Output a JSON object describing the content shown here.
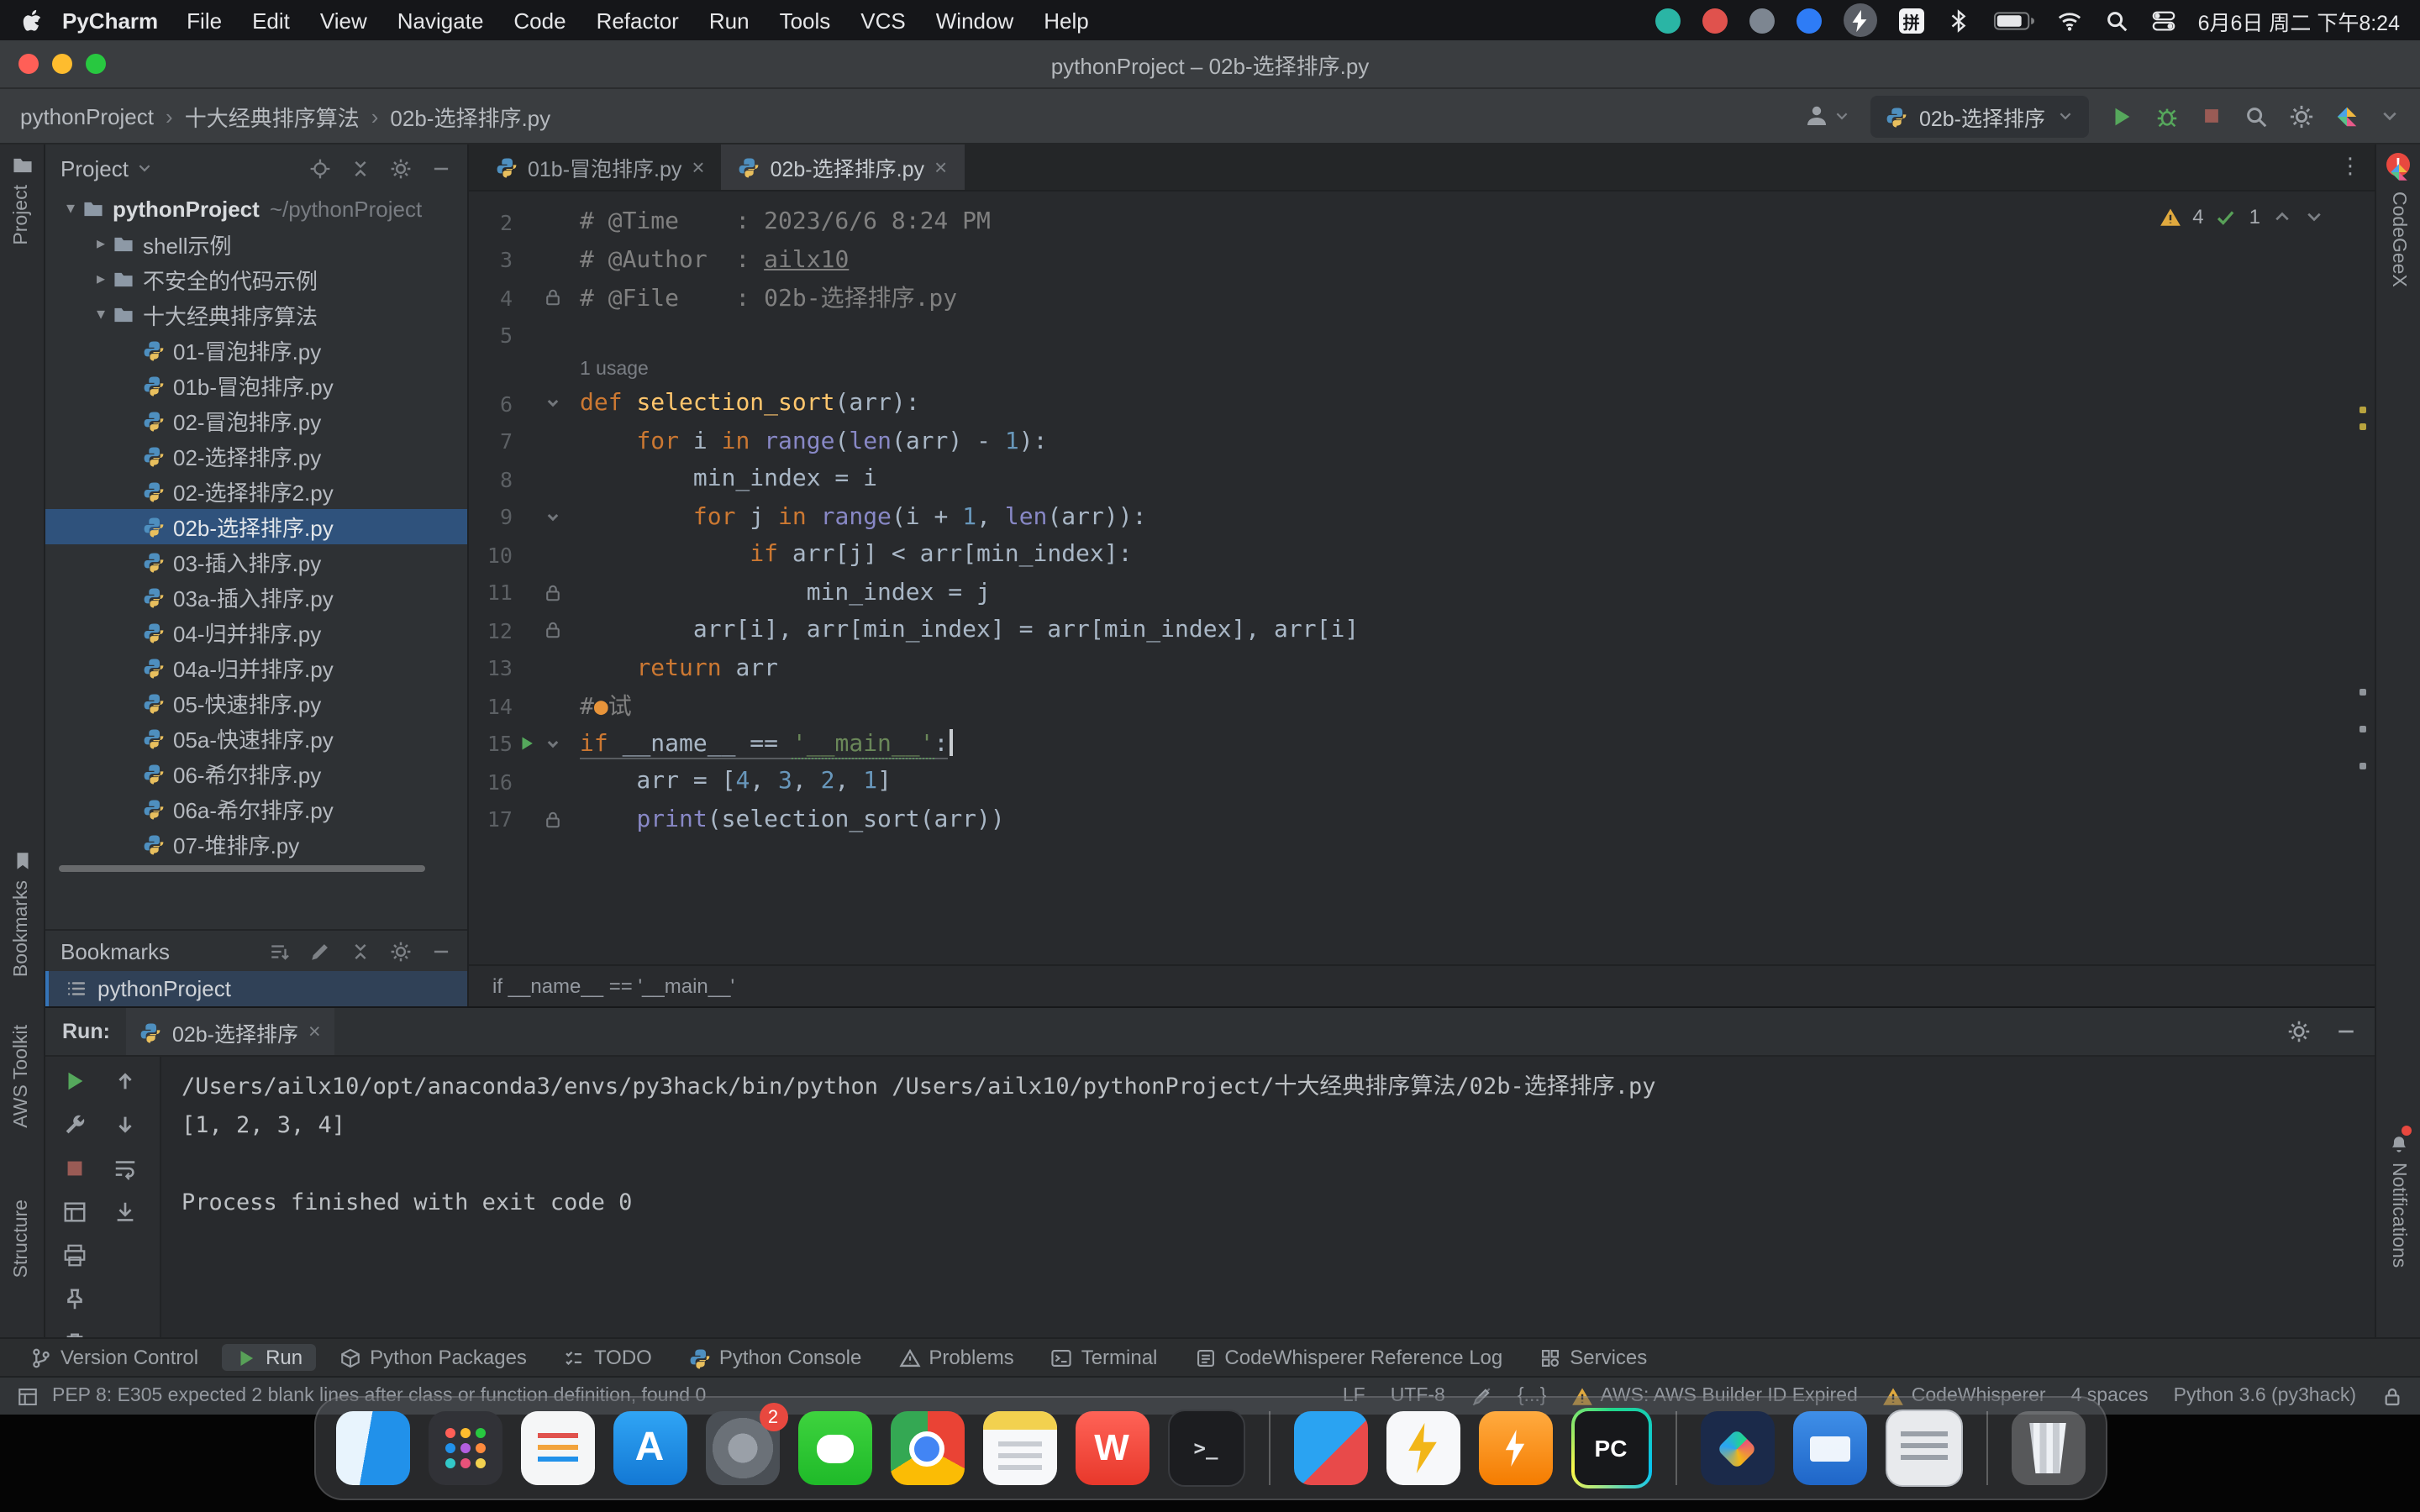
{
  "menubar": {
    "app_name": "PyCharm",
    "menus": [
      "File",
      "Edit",
      "View",
      "Navigate",
      "Code",
      "Refactor",
      "Run",
      "Tools",
      "VCS",
      "Window",
      "Help"
    ],
    "status_icons": [
      {
        "name": "status-teal-icon"
      },
      {
        "name": "status-red-icon"
      },
      {
        "name": "status-gray-icon"
      },
      {
        "name": "status-blue-icon"
      },
      {
        "name": "status-bolt-icon"
      },
      {
        "name": "input-method-icon",
        "glyph": "拼"
      },
      {
        "name": "bluetooth-icon"
      },
      {
        "name": "battery-icon"
      },
      {
        "name": "wifi-icon"
      },
      {
        "name": "spotlight-icon"
      },
      {
        "name": "control-center-icon"
      }
    ],
    "clock": "6月6日 周二 下午8:24"
  },
  "titlebar": {
    "title": "pythonProject – 02b-选择排序.py"
  },
  "toolbar": {
    "breadcrumbs": [
      "pythonProject",
      "十大经典排序算法",
      "02b-选择排序.py"
    ],
    "run_config": "02b-选择排序"
  },
  "left_stripe": {
    "items": [
      {
        "id": "project",
        "label": "Project",
        "icon": "folder-icon"
      },
      {
        "id": "bookmarks",
        "label": "Bookmarks",
        "icon": "bookmark-icon"
      },
      {
        "id": "aws",
        "label": "AWS Toolkit"
      },
      {
        "id": "structure",
        "label": "Structure"
      }
    ]
  },
  "right_stripe": {
    "items": [
      {
        "id": "codegeex",
        "label": "CodeGeeX",
        "icon": "codegeex-icon"
      },
      {
        "id": "notifications",
        "label": "Notifications",
        "icon": "bell-icon"
      }
    ]
  },
  "project": {
    "header": "Project",
    "header_icons": [
      "target-icon",
      "collapse-icon",
      "gear-icon",
      "minus-icon"
    ],
    "tree": [
      {
        "label": "pythonProject",
        "hint": "~/pythonProject",
        "type": "root",
        "indent": 0,
        "arrow": "expanded"
      },
      {
        "label": "shell示例",
        "type": "folder",
        "indent": 1,
        "arrow": "collapsed"
      },
      {
        "label": "不安全的代码示例",
        "type": "folder",
        "indent": 1,
        "arrow": "collapsed"
      },
      {
        "label": "十大经典排序算法",
        "type": "folder",
        "indent": 1,
        "arrow": "expanded"
      },
      {
        "label": "01-冒泡排序.py",
        "type": "pyfile",
        "indent": 2
      },
      {
        "label": "01b-冒泡排序.py",
        "type": "pyfile",
        "indent": 2
      },
      {
        "label": "02-冒泡排序.py",
        "type": "pyfile",
        "indent": 2
      },
      {
        "label": "02-选择排序.py",
        "type": "pyfile",
        "indent": 2
      },
      {
        "label": "02-选择排序2.py",
        "type": "pyfile",
        "indent": 2
      },
      {
        "label": "02b-选择排序.py",
        "type": "pyfile",
        "indent": 2,
        "selected": true
      },
      {
        "label": "03-插入排序.py",
        "type": "pyfile",
        "indent": 2
      },
      {
        "label": "03a-插入排序.py",
        "type": "pyfile",
        "indent": 2
      },
      {
        "label": "04-归并排序.py",
        "type": "pyfile",
        "indent": 2
      },
      {
        "label": "04a-归并排序.py",
        "type": "pyfile",
        "indent": 2
      },
      {
        "label": "05-快速排序.py",
        "type": "pyfile",
        "indent": 2
      },
      {
        "label": "05a-快速排序.py",
        "type": "pyfile",
        "indent": 2
      },
      {
        "label": "06-希尔排序.py",
        "type": "pyfile",
        "indent": 2
      },
      {
        "label": "06a-希尔排序.py",
        "type": "pyfile",
        "indent": 2
      },
      {
        "label": "07-堆排序.py",
        "type": "pyfile",
        "indent": 2
      }
    ]
  },
  "bookmarks": {
    "header": "Bookmarks",
    "header_icons": [
      "sort-icon",
      "pencil-icon",
      "collapse-icon",
      "gear-icon",
      "minus-icon"
    ],
    "items": [
      {
        "label": "pythonProject"
      }
    ]
  },
  "editor": {
    "tabs": [
      {
        "label": "01b-冒泡排序.py",
        "active": false
      },
      {
        "label": "02b-选择排序.py",
        "active": true
      }
    ],
    "inspections": {
      "warnings": "4",
      "passed": "1"
    },
    "breadcrumb": "if __name__ == '__main__'",
    "lines": [
      {
        "n": "2",
        "tokens": [
          {
            "t": "# @Time    : 2023/6/6 8:24 PM",
            "c": "com"
          }
        ]
      },
      {
        "n": "3",
        "tokens": [
          {
            "t": "# @Author  : ",
            "c": "com"
          },
          {
            "t": "ailx10",
            "c": "com und"
          }
        ]
      },
      {
        "n": "4",
        "g2": "lock",
        "tokens": [
          {
            "t": "# @File    : 02b-选择排序.py",
            "c": "com"
          }
        ]
      },
      {
        "n": "5",
        "tokens": []
      },
      {
        "hint": "1 usage"
      },
      {
        "n": "6",
        "g2": "fold",
        "tokens": [
          {
            "t": "def ",
            "c": "kw"
          },
          {
            "t": "selection_sort",
            "c": "fn"
          },
          {
            "t": "(arr):",
            "c": "pl"
          }
        ]
      },
      {
        "n": "7",
        "tokens": [
          {
            "t": "    ",
            "c": "pl"
          },
          {
            "t": "for ",
            "c": "kw"
          },
          {
            "t": "i ",
            "c": "pl"
          },
          {
            "t": "in ",
            "c": "kw"
          },
          {
            "t": "range",
            "c": "bi"
          },
          {
            "t": "(",
            "c": "pl"
          },
          {
            "t": "len",
            "c": "bi"
          },
          {
            "t": "(arr) - ",
            "c": "pl"
          },
          {
            "t": "1",
            "c": "num"
          },
          {
            "t": "):",
            "c": "pl"
          }
        ]
      },
      {
        "n": "8",
        "tokens": [
          {
            "t": "        min_index = i",
            "c": "pl"
          }
        ]
      },
      {
        "n": "9",
        "g2": "fold",
        "tokens": [
          {
            "t": "        ",
            "c": "pl"
          },
          {
            "t": "for ",
            "c": "kw"
          },
          {
            "t": "j ",
            "c": "pl"
          },
          {
            "t": "in ",
            "c": "kw"
          },
          {
            "t": "range",
            "c": "bi"
          },
          {
            "t": "(i + ",
            "c": "pl"
          },
          {
            "t": "1",
            "c": "num"
          },
          {
            "t": ", ",
            "c": "pl"
          },
          {
            "t": "len",
            "c": "bi"
          },
          {
            "t": "(arr)):",
            "c": "pl"
          }
        ]
      },
      {
        "n": "10",
        "tokens": [
          {
            "t": "            ",
            "c": "pl"
          },
          {
            "t": "if ",
            "c": "kw"
          },
          {
            "t": "arr[j] < arr[min_index]:",
            "c": "pl"
          }
        ]
      },
      {
        "n": "11",
        "g2": "lock",
        "tokens": [
          {
            "t": "                min_index = j",
            "c": "pl"
          }
        ]
      },
      {
        "n": "12",
        "g2": "lock",
        "tokens": [
          {
            "t": "        arr[i], arr[min_index] = arr[min_index], arr[i]",
            "c": "pl"
          }
        ]
      },
      {
        "n": "13",
        "tokens": [
          {
            "t": "    ",
            "c": "pl"
          },
          {
            "t": "return ",
            "c": "kw"
          },
          {
            "t": "arr",
            "c": "pl"
          }
        ]
      },
      {
        "n": "14",
        "tokens": [
          {
            "t": "#",
            "c": "com"
          },
          {
            "t": "●",
            "c": "dot"
          },
          {
            "t": "试",
            "c": "com"
          }
        ]
      },
      {
        "n": "15",
        "g1": "run",
        "g2": "fold",
        "cls": "caret-line",
        "tokens": [
          {
            "t": "if ",
            "c": "kw"
          },
          {
            "t": "__name__ == ",
            "c": "pl"
          },
          {
            "t": "'__main__'",
            "c": "str dotted"
          },
          {
            "t": ":",
            "c": "pl"
          }
        ]
      },
      {
        "n": "16",
        "tokens": [
          {
            "t": "    arr = [",
            "c": "pl"
          },
          {
            "t": "4",
            "c": "num"
          },
          {
            "t": ", ",
            "c": "pl"
          },
          {
            "t": "3",
            "c": "num"
          },
          {
            "t": ", ",
            "c": "pl"
          },
          {
            "t": "2",
            "c": "num"
          },
          {
            "t": ", ",
            "c": "pl"
          },
          {
            "t": "1",
            "c": "num"
          },
          {
            "t": "]",
            "c": "pl"
          }
        ]
      },
      {
        "n": "17",
        "g2": "lock",
        "tokens": [
          {
            "t": "    ",
            "c": "pl"
          },
          {
            "t": "print",
            "c": "bi"
          },
          {
            "t": "(selection_sort(arr))",
            "c": "pl"
          }
        ]
      }
    ]
  },
  "run_panel": {
    "label": "Run:",
    "tab": "02b-选择排序",
    "toolbar_col1": [
      "rerun-icon",
      "wrench-icon",
      "stop2-icon",
      "layout-icon",
      "printer-icon",
      "pin-icon",
      "trash-icon"
    ],
    "toolbar_col2": [
      "up-icon",
      "down-icon",
      "softwrap-icon",
      "scrollend-icon"
    ],
    "console": [
      "/Users/ailx10/opt/anaconda3/envs/py3hack/bin/python /Users/ailx10/pythonProject/十大经典排序算法/02b-选择排序.py",
      "[1, 2, 3, 4]",
      "",
      "Process finished with exit code 0"
    ]
  },
  "bottom_bar": {
    "tabs": [
      {
        "label": "Version Control",
        "icon": "branch-icon"
      },
      {
        "label": "Run",
        "icon": "play-icon",
        "active": true
      },
      {
        "label": "Python Packages",
        "icon": "package-icon"
      },
      {
        "label": "TODO",
        "icon": "todo-icon"
      },
      {
        "label": "Python Console",
        "icon": "python-icon"
      },
      {
        "label": "Problems",
        "icon": "problems-icon"
      },
      {
        "label": "Terminal",
        "icon": "terminal-icon"
      },
      {
        "label": "CodeWhisperer Reference Log",
        "icon": "doc-icon"
      },
      {
        "label": "Services",
        "icon": "services-icon"
      }
    ]
  },
  "status_bar": {
    "message": "PEP 8: E305 expected 2 blank lines after class or function definition, found 0",
    "right": [
      {
        "text": "LF",
        "name": "line-separator-indicator"
      },
      {
        "text": "UTF-8",
        "name": "encoding-indicator"
      },
      {
        "icon": "readonly-icon",
        "name": "readonly-toggle"
      },
      {
        "text": "{...}",
        "name": "code-style-indicator"
      },
      {
        "icon": "warning-icon",
        "text": "AWS: AWS Builder ID Expired",
        "name": "aws-status"
      },
      {
        "icon": "warning-icon",
        "text": "CodeWhisperer",
        "name": "codewhisperer-status"
      },
      {
        "text": "4 spaces",
        "name": "indent-indicator"
      },
      {
        "text": "Python 3.6 (py3hack)",
        "name": "interpreter-indicator"
      },
      {
        "icon": "lock-icon",
        "name": "lock-indicator"
      }
    ]
  },
  "dock": {
    "items": [
      {
        "name": "finder"
      },
      {
        "name": "launchpad"
      },
      {
        "name": "reminders"
      },
      {
        "name": "app-store",
        "glyph": "A"
      },
      {
        "name": "system-settings",
        "badge": "2"
      },
      {
        "name": "wechat"
      },
      {
        "name": "chrome"
      },
      {
        "name": "notes"
      },
      {
        "name": "wps",
        "glyph": "W"
      },
      {
        "name": "terminal",
        "glyph": ">_"
      },
      {
        "sep": true
      },
      {
        "name": "netdisk"
      },
      {
        "name": "thunder"
      },
      {
        "name": "security"
      },
      {
        "name": "pycharm",
        "glyph": "PC"
      },
      {
        "sep": true
      },
      {
        "name": "dark-app"
      },
      {
        "name": "remote-app"
      },
      {
        "name": "preview-window"
      },
      {
        "sep": true
      },
      {
        "name": "trash"
      }
    ]
  }
}
